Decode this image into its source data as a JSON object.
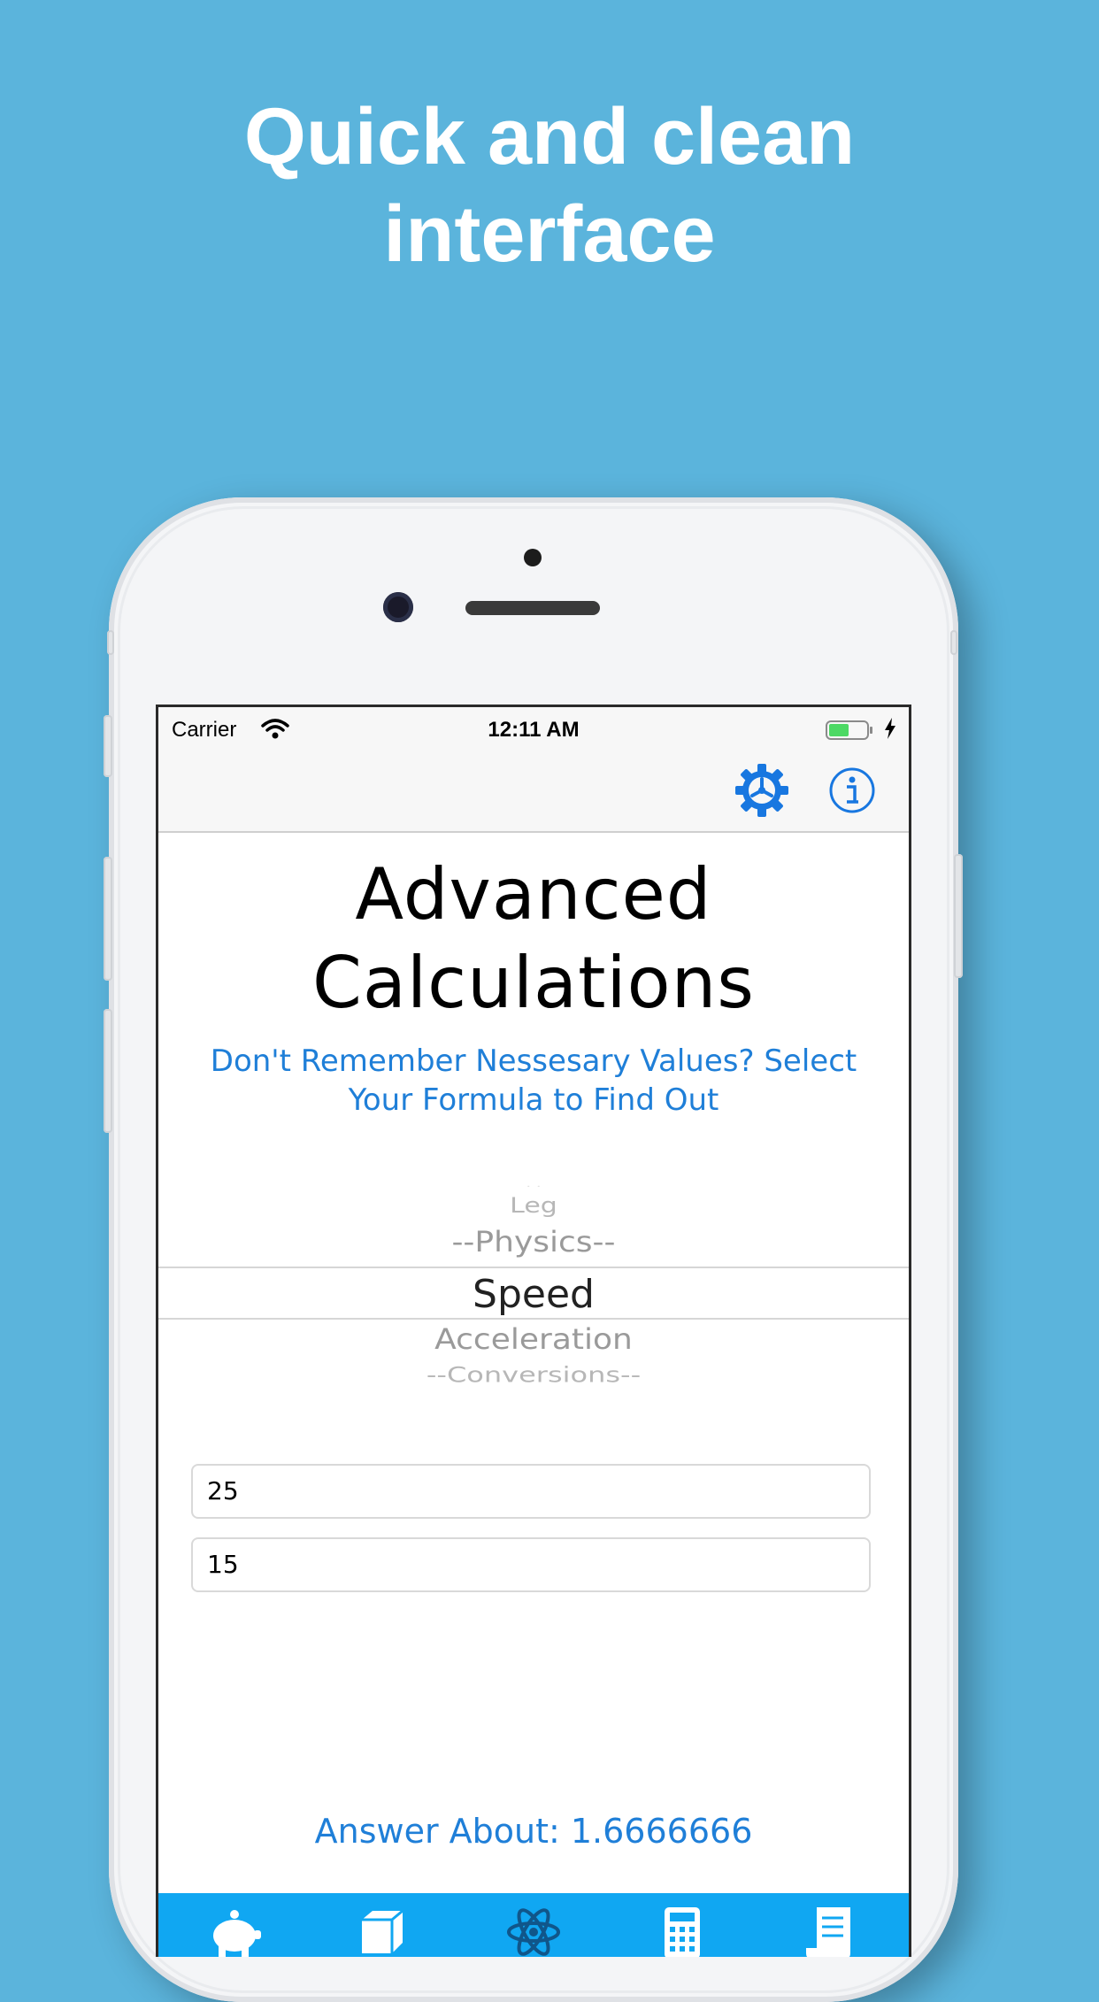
{
  "headline": {
    "line1": "Quick and clean",
    "line2": "interface"
  },
  "status_bar": {
    "carrier": "Carrier",
    "time": "12:11 AM"
  },
  "nav_bar": {
    "settings_icon": "gear-icon",
    "info_icon": "info-icon"
  },
  "main": {
    "title_line1": "Advanced",
    "title_line2": "Calculations",
    "subtitle_line1": "Don't Remember Nessesary Values? Select",
    "subtitle_line2": "Your Formula to Find Out"
  },
  "picker": {
    "items": [
      "Leg",
      "--Physics--",
      "Speed",
      "Acceleration",
      "--Conversions--"
    ],
    "selected": "Speed"
  },
  "inputs": [
    {
      "value": "25"
    },
    {
      "value": "15"
    }
  ],
  "answer": "Answer About: 1.6666666",
  "tab_bar": {
    "tabs": [
      "piggy-bank-icon",
      "cube-icon",
      "atom-icon",
      "calculator-icon",
      "document-icon"
    ]
  },
  "colors": {
    "background": "#5bb4dc",
    "accent": "#1f7fd8",
    "tab_bar": "#10a7f2"
  }
}
